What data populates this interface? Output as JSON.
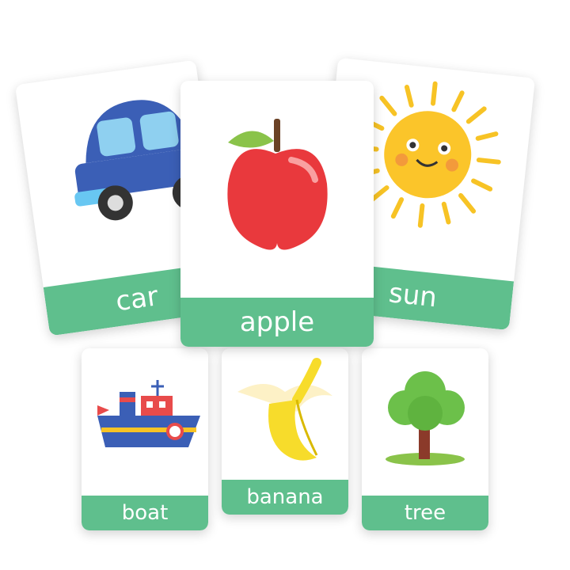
{
  "cards": {
    "car": {
      "label": "car",
      "icon": "car-icon"
    },
    "apple": {
      "label": "apple",
      "icon": "apple-icon"
    },
    "sun": {
      "label": "sun",
      "icon": "sun-icon"
    },
    "boat": {
      "label": "boat",
      "icon": "boat-icon"
    },
    "banana": {
      "label": "banana",
      "icon": "banana-icon"
    },
    "tree": {
      "label": "tree",
      "icon": "tree-icon"
    }
  },
  "colors": {
    "label_bg": "#5fbf8d",
    "card_bg": "#ffffff"
  }
}
